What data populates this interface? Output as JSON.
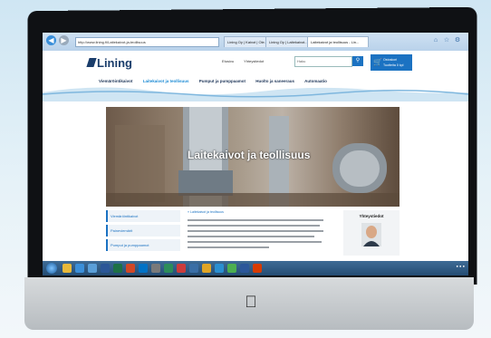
{
  "browser": {
    "address": "http://www.lining.fi/Laitekaivot-ja-teollisuus",
    "tabs": [
      "Lining Oy | Kaivot | Ole...",
      "Lining Oy | Laitekaivot...",
      "Laitekaivot ja teollisuus - Lin..."
    ]
  },
  "header": {
    "logo": "Lining",
    "top_links": [
      "Etusivu",
      "Yhteystiedot"
    ],
    "search_placeholder": "Haku",
    "cart_lines": [
      "Ostoskori",
      "Tuotteita 0 kpl"
    ]
  },
  "nav": [
    {
      "label": "Viemäröintikaivot",
      "active": false
    },
    {
      "label": "Laitekaivot ja teollisuus",
      "active": true
    },
    {
      "label": "Pumput ja pumppaamot",
      "active": false
    },
    {
      "label": "Huolto ja saneeraus",
      "active": false
    },
    {
      "label": "Automaatio",
      "active": false
    }
  ],
  "hero": {
    "title": "Laitekaivot ja teollisuus"
  },
  "sidebar": {
    "items": [
      "Viemäröintikaivot",
      "Paineviemärit",
      "Pumput ja pumppaamot"
    ]
  },
  "article": {
    "breadcrumb": "» Laitekaivot ja teollisuus"
  },
  "contact": {
    "title": "Yhteystiedot"
  },
  "colors": {
    "brand": "#1a3d6b",
    "accent": "#1b72c2"
  }
}
